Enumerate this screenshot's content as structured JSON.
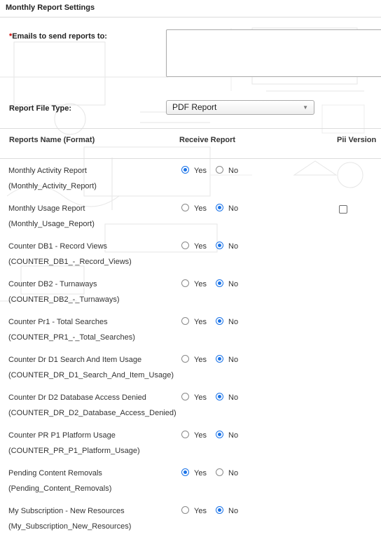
{
  "section": {
    "title": "Monthly Report Settings"
  },
  "emails": {
    "required_mark": "*",
    "label": "Emails to send reports to:",
    "value": ""
  },
  "file_type": {
    "label": "Report File Type:",
    "selected": "PDF Report"
  },
  "columns": {
    "name": "Reports Name (Format)",
    "receive": "Receive Report",
    "pii": "Pii Version"
  },
  "options": {
    "yes": "Yes",
    "no": "No"
  },
  "reports": [
    {
      "name": "Monthly Activity Report",
      "code": "(Monthly_Activity_Report)",
      "receive": "yes",
      "pii_checkbox": false
    },
    {
      "name": "Monthly Usage Report",
      "code": "(Monthly_Usage_Report)",
      "receive": "no",
      "pii_checkbox": true
    },
    {
      "name": "Counter DB1 - Record Views",
      "code": "(COUNTER_DB1_-_Record_Views)",
      "receive": "no",
      "pii_checkbox": false
    },
    {
      "name": "Counter DB2 - Turnaways",
      "code": "(COUNTER_DB2_-_Turnaways)",
      "receive": "no",
      "pii_checkbox": false
    },
    {
      "name": "Counter Pr1 - Total Searches",
      "code": "(COUNTER_PR1_-_Total_Searches)",
      "receive": "no",
      "pii_checkbox": false
    },
    {
      "name": "Counter Dr D1 Search And Item Usage",
      "code": "(COUNTER_DR_D1_Search_And_Item_Usage)",
      "receive": "no",
      "pii_checkbox": false
    },
    {
      "name": "Counter Dr D2 Database Access Denied",
      "code": "(COUNTER_DR_D2_Database_Access_Denied)",
      "receive": "no",
      "pii_checkbox": false
    },
    {
      "name": "Counter PR P1 Platform Usage",
      "code": "(COUNTER_PR_P1_Platform_Usage)",
      "receive": "no",
      "pii_checkbox": false
    },
    {
      "name": "Pending Content Removals",
      "code": "(Pending_Content_Removals)",
      "receive": "yes",
      "pii_checkbox": false
    },
    {
      "name": "My Subscription - New Resources",
      "code": "(My_Subscription_New_Resources)",
      "receive": "no",
      "pii_checkbox": false
    }
  ],
  "colors": {
    "radio_selected": "#1a73e8",
    "required": "#cc0000",
    "divider": "#dcdcdc"
  }
}
